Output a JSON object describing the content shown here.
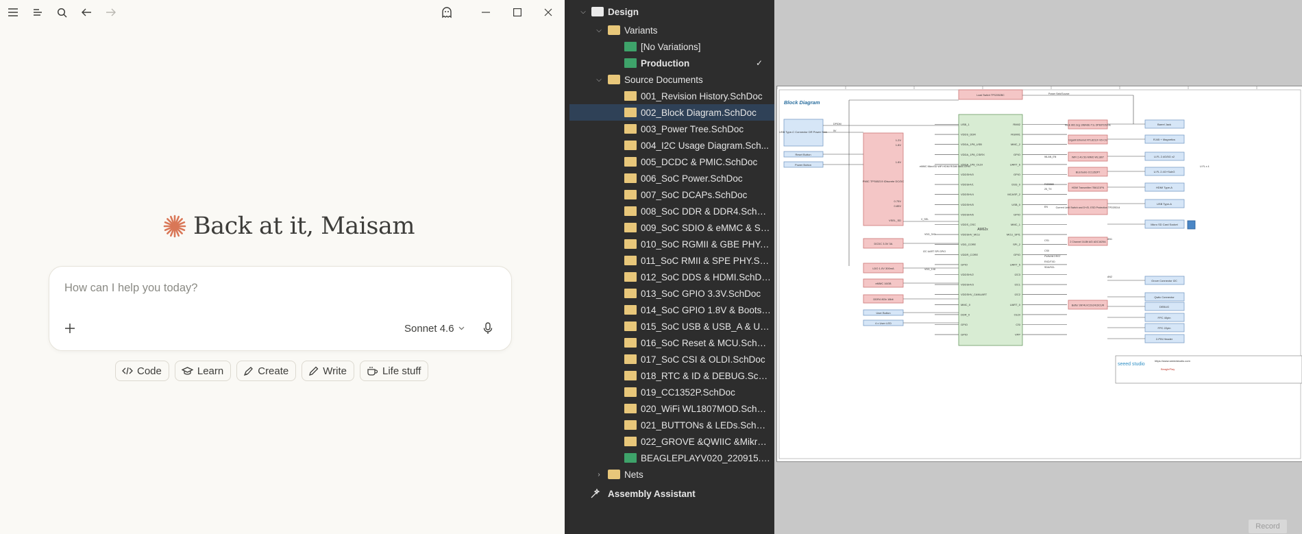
{
  "chat": {
    "greeting": "Back at it, Maisam",
    "prompt_placeholder": "How can I help you today?",
    "model": "Sonnet 4.6",
    "chips": [
      "Code",
      "Learn",
      "Create",
      "Write",
      "Life stuff"
    ],
    "accent_color": "#d97757",
    "icons": [
      "sidebar-toggle-icon",
      "list-icon",
      "search-icon",
      "back-arrow-icon",
      "forward-arrow-icon",
      "ghost-icon",
      "minimize-icon",
      "maximize-icon",
      "close-icon",
      "plus-icon",
      "chevron-down-icon",
      "microphone-icon"
    ]
  },
  "tree": {
    "root": "Design",
    "variants_folder": "Variants",
    "variants": [
      "[No Variations]",
      "Production"
    ],
    "source_folder": "Source Documents",
    "documents": [
      "001_Revision History.SchDoc",
      "002_Block Diagram.SchDoc",
      "003_Power Tree.SchDoc",
      "004_I2C Usage Diagram.Sch...",
      "005_DCDC & PMIC.SchDoc",
      "006_SoC Power.SchDoc",
      "007_SoC DCAPs.SchDoc",
      "008_SoC DDR & DDR4.SchDoc",
      "009_SoC SDIO & eMMC & SD....",
      "010_SoC RGMII & GBE PHY.S...",
      "011_SoC RMII & SPE PHY.Sch...",
      "012_SoC DDS & HDMI.SchDoc",
      "013_SoC GPIO 3.3V.SchDoc",
      "014_SoC GPIO 1.8V & Bootstr...",
      "015_SoC USB & USB_A & USB...",
      "016_SoC Reset & MCU.SchDoc",
      "017_SoC CSI & OLDI.SchDoc",
      "018_RTC & ID & DEBUG.SchDoc",
      "019_CC1352P.SchDoc",
      "020_WiFi WL1807MOD.SchDoc",
      "021_BUTTONs & LEDs.SchDoc",
      "022_GROVE &QWIIC &MikroB...",
      "BEAGLEPLAYV020_220915.br..."
    ],
    "nets_folder": "Nets",
    "assistant": "Assembly Assistant"
  },
  "schematic": {
    "title": "Block Diagram",
    "left_blocks": [
      "USB Type-C Connector DR Power Sink",
      "Reset Button",
      "Power Button"
    ],
    "pmic": "PMIC TPS65219 iDiscrete DC/DC",
    "pmic_rails": [
      "1.2V",
      "1.8V",
      "1.8V",
      "0.75V",
      "0.85V",
      "VSEL_SD"
    ],
    "dcdc": "DCDC 3.3V 3A",
    "ldo": "LDO 1.0V 300mA",
    "emmc": "eMMC 16GB",
    "ddr": "DDR4 8Gb 16bit",
    "user_button": "User Button",
    "user_led": "4 x User LED",
    "soc": "AM62x",
    "soc_left_pins": [
      "USB_1",
      "VDDS_DDR",
      "VDDA_1P8_USB",
      "VDDA_1P8_CSIRX",
      "VDDA_1P8_OLDI",
      "VDDSHV0",
      "VDDSHV1",
      "VDDSHV4",
      "VDDSHV5",
      "VDDSHV6",
      "VDDS_OSC",
      "VDDSHV_MCU",
      "VDD_CORE",
      "VDDR_CORE",
      "GPIO",
      "VDDSHV2",
      "VDDSHV3",
      "VDDSHV_CANUART",
      "MMC_0",
      "DDR_0",
      "GPIO",
      "GPIO"
    ],
    "soc_right_pins": [
      "RMII2",
      "RGMII1",
      "MMC_2",
      "GPIO",
      "UART_6",
      "GPIO",
      "DSS_0",
      "MCASP_2",
      "USB_0",
      "GPIO",
      "MMC_1",
      "MCU_SPI1",
      "SPI_2",
      "GPIO",
      "UART_5",
      "I2C3",
      "I2C1",
      "I2C2",
      "UART_0",
      "OLDI",
      "CSI",
      "VPP"
    ],
    "mid_blocks": [
      "Load Switch TPS2052BC",
      "IEEE 802.3cg 10BASE-T1L DP83TD510E",
      "Gigabit Ethernet RTL8211F-VD-CG",
      "WiFi 2.4G 5G MIMO WL1807",
      "BLE/SubG CC1352P7",
      "HDMI Transmitter IT66121FN",
      "Current Limit Switch and D+/D- ESD Protection TPD3S014",
      "2 Channel 16-Bit A/D ADC1629A",
      "Buffer SN74LVC2G241DCUR"
    ],
    "right_blocks": [
      "Barrel Jack",
      "RJ45 + Magnetics",
      "U.FL 2.4G/5G x2",
      "U.FL 2.4G+SubG",
      "HDMI Type-A",
      "USB Type-A",
      "Micro SD Card Socket",
      "Grove Connector I2C",
      "Qwiic Connector",
      "DEBUG",
      "FPC 40pin",
      "FPC 22pin",
      "2-PIN Header"
    ],
    "labels": [
      "Power Sink/Source",
      "DP/DM",
      "5V",
      "VDD_3V3",
      "V_SEL",
      "VDD_1V8",
      "WLAN_EN",
      "RGB565",
      "25_TX",
      "EN",
      "CS1",
      "CS0",
      "PWM/INT/RST",
      "RXD/TXD",
      "SDA/SCL",
      "AN1",
      "AN2",
      "I2C UART SPI GPIO",
      "eMMC MicroSD WiFi HDMI RGMII BMS GPIO",
      "U.FL x 4"
    ],
    "footer": [
      "seeed studio",
      "https://www.seeedstudio.com",
      "BeaglePlay"
    ]
  },
  "record_label": "Record"
}
